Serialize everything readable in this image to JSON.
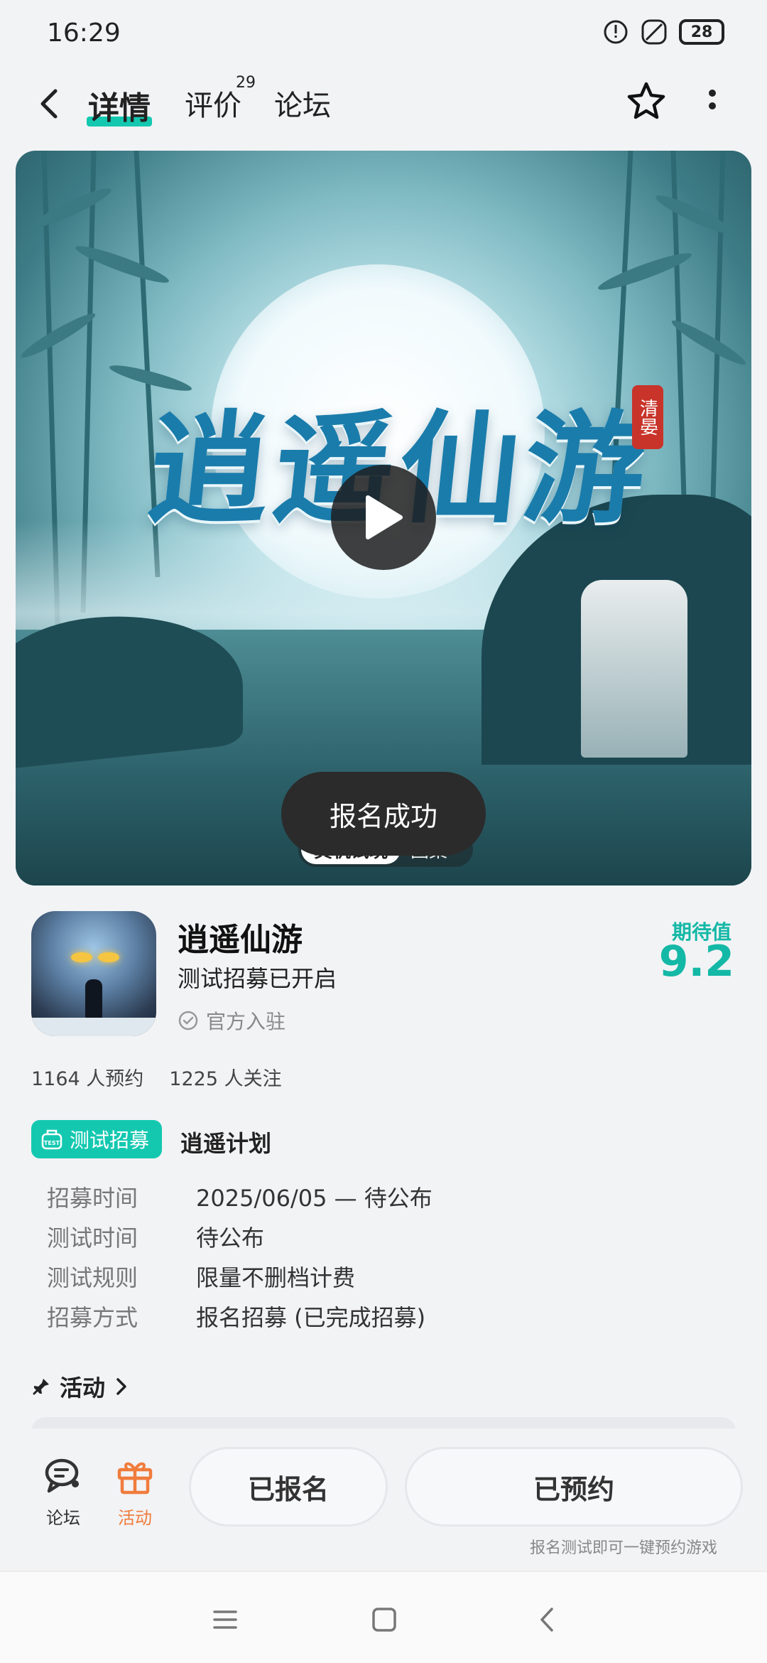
{
  "status_bar": {
    "time": "16:29",
    "battery": "28"
  },
  "header": {
    "tabs": [
      {
        "label": "详情",
        "active": true
      },
      {
        "label": "评价",
        "count": "29"
      },
      {
        "label": "论坛"
      }
    ]
  },
  "hero": {
    "logo_text": "逍遥仙游",
    "seal_text": "清晏",
    "tags": [
      "真机试玩",
      "图集"
    ],
    "toast": "报名成功"
  },
  "game": {
    "title": "逍遥仙游",
    "subtitle": "测试招募已开启",
    "official_label": "官方入驻",
    "expect_label": "期待值",
    "expect_value": "9.2",
    "reservations": "1164 人预约",
    "followers": "1225 人关注"
  },
  "recruit": {
    "badge": "测试招募",
    "plan_name": "逍遥计划",
    "rows": [
      {
        "key": "招募时间",
        "value": "2025/06/05 — 待公布"
      },
      {
        "key": "测试时间",
        "value": "待公布"
      },
      {
        "key": "测试规则",
        "value": "限量不删档计费"
      },
      {
        "key": "招募方式",
        "value": "报名招募 (已完成招募)"
      }
    ]
  },
  "activity": {
    "title": "活动"
  },
  "action_bar": {
    "forum_label": "论坛",
    "activity_label": "活动",
    "registered_label": "已报名",
    "reserved_label": "已预约",
    "hint": "报名测试即可一键预约游戏"
  },
  "colors": {
    "accent": "#14c8b0",
    "activity_orange": "#f07c3c",
    "toast_bg": "#2b2b2b"
  }
}
